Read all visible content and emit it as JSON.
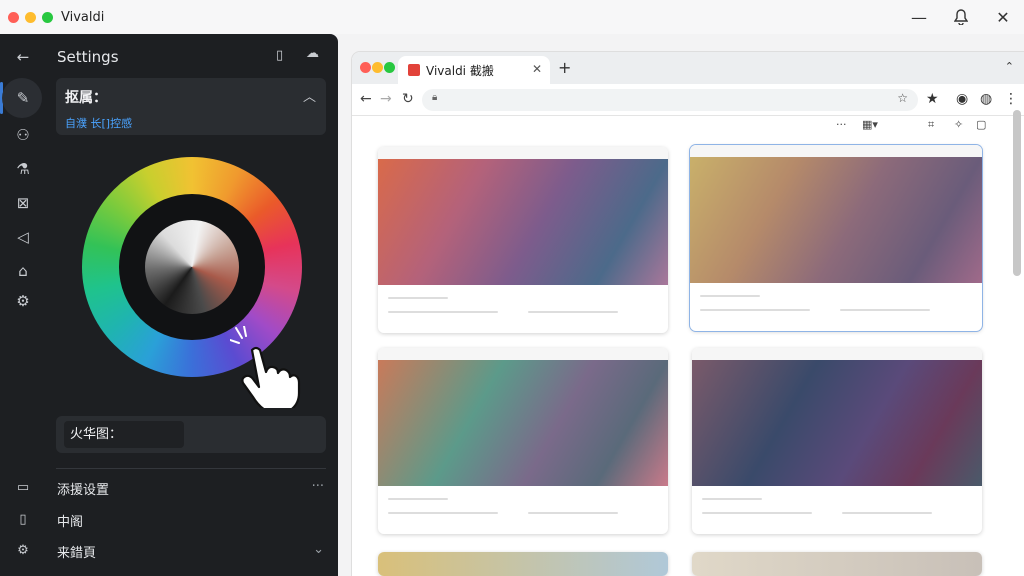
{
  "os": {
    "title": "Vivaldi"
  },
  "settings": {
    "title": "Settings",
    "card": {
      "title": "抠属：",
      "link": "自濮 长[]控感"
    },
    "input_label": "火华图：",
    "list": [
      {
        "icon": "folder-icon",
        "label": "添援设置",
        "trail": "···"
      },
      {
        "icon": "clipboard-icon",
        "label": "中阁",
        "trail": ""
      },
      {
        "icon": "gear-icon",
        "label": "来錯頁",
        "trail": "⌄"
      }
    ]
  },
  "browser": {
    "tab_title": "Vivaldi 截搬"
  },
  "colors": {
    "panel_bg": "#1d1f22",
    "accent": "#3a7bd5",
    "link": "#4aa3ff"
  }
}
